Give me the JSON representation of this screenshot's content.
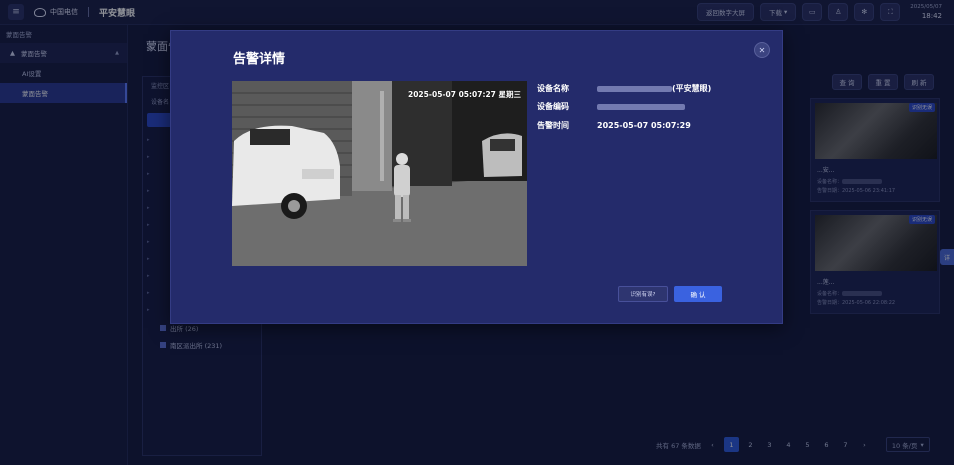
{
  "topbar": {
    "menu_icon": "hamburger-icon",
    "logo_text": "中国电信",
    "brand": "平安慧眼",
    "return_btn": "返回数字大屏",
    "download_btn": "下载",
    "date": "2025/05/07",
    "time": "18:42"
  },
  "sidebar": {
    "header": "蒙面告警",
    "group": "蒙面告警",
    "items": [
      {
        "label": "AI设置",
        "active": false
      },
      {
        "label": "蒙面告警",
        "active": true
      }
    ]
  },
  "main": {
    "title": "蒙面告警",
    "left_panel": {
      "row1": "监控区",
      "row2": "设备名"
    },
    "tree": [
      {
        "label": "出所 (26)"
      },
      {
        "label": "南区派出所 (231)"
      }
    ],
    "buttons": {
      "search": "查 询",
      "reset": "重 置",
      "refresh": "刷 新"
    },
    "cards": [
      {
        "badge": "识别无误",
        "name": "...安...",
        "device": "设备名称：",
        "date": "告警日期：2025-05-06 23:41:17"
      },
      {
        "badge": "识别无误",
        "name": "...莲...",
        "device": "设备名称：",
        "date": "告警日期：2025-05-06 22:08:22"
      }
    ],
    "side_tab": "详",
    "pagination": {
      "total": "共有 67 条数据",
      "pages": [
        "1",
        "2",
        "3",
        "4",
        "5",
        "6",
        "7"
      ],
      "current": "1",
      "page_size": "10 条/页"
    }
  },
  "modal": {
    "title": "告警详情",
    "photo_timestamp": "2025-05-07  05:07:27  星期三",
    "fields": {
      "device_name_label": "设备名称",
      "device_name_suffix": "(平安慧眼)",
      "device_code_label": "设备编码",
      "alarm_time_label": "告警时间",
      "alarm_time_value": "2025-05-07 05:07:29"
    },
    "misidentify_btn": "识别有误?",
    "confirm_btn": "确 认"
  }
}
